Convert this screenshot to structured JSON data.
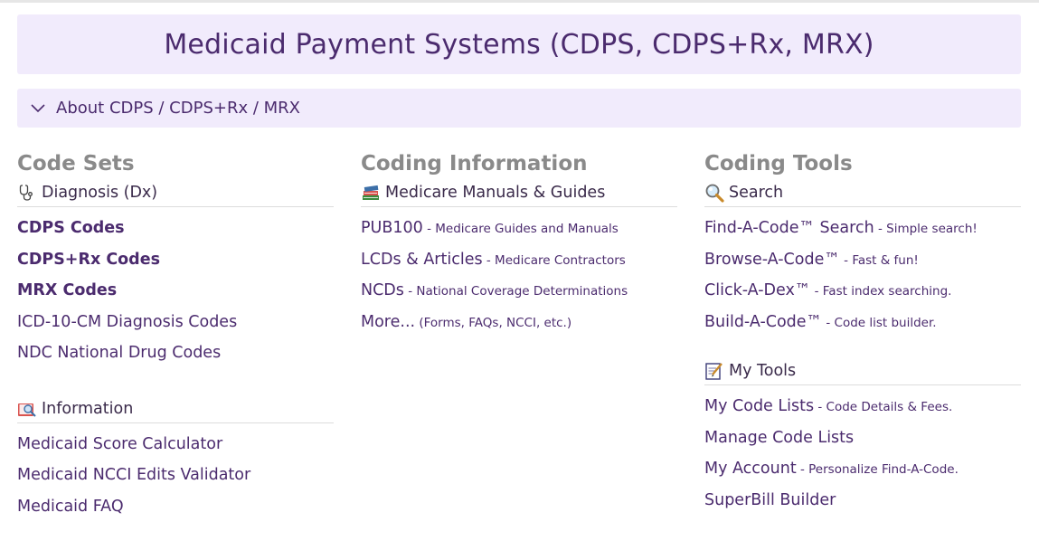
{
  "header": {
    "title": "Medicaid Payment Systems (CDPS, CDPS+Rx, MRX)"
  },
  "about": {
    "label": "About CDPS / CDPS+Rx / MRX",
    "icon": "chevron-down-icon"
  },
  "columns": {
    "code_sets": {
      "title": "Code Sets",
      "diagnosis": {
        "heading": "Diagnosis (Dx)",
        "icon": "stethoscope-icon",
        "items": [
          {
            "label": "CDPS Codes"
          },
          {
            "label": "CDPS+Rx Codes"
          },
          {
            "label": "MRX Codes"
          },
          {
            "label": "ICD-10-CM Diagnosis Codes"
          },
          {
            "label": "NDC National Drug Codes"
          }
        ]
      },
      "information": {
        "heading": "Information",
        "icon": "book-search-icon",
        "items": [
          {
            "label": "Medicaid Score Calculator"
          },
          {
            "label": "Medicaid NCCI Edits Validator"
          },
          {
            "label": "Medicaid FAQ"
          }
        ]
      }
    },
    "coding_information": {
      "title": "Coding Information",
      "manuals": {
        "heading": "Medicare Manuals & Guides",
        "icon": "books-icon",
        "items": [
          {
            "label": "PUB100",
            "desc": " - Medicare Guides and Manuals"
          },
          {
            "label": "LCDs & Articles",
            "desc": " - Medicare Contractors"
          },
          {
            "label": "NCDs",
            "desc": " - National Coverage Determinations"
          },
          {
            "label": "More...",
            "desc": " (Forms, FAQs, NCCI, etc.)"
          }
        ]
      }
    },
    "coding_tools": {
      "title": "Coding Tools",
      "search": {
        "heading": "Search",
        "icon": "magnifier-icon",
        "items": [
          {
            "label": "Find-A-Code™ Search",
            "desc": " - Simple search!"
          },
          {
            "label": "Browse-A-Code™",
            "desc": " - Fast & fun!"
          },
          {
            "label": "Click-A-Dex™",
            "desc": " - Fast index searching."
          },
          {
            "label": "Build-A-Code™",
            "desc": " - Code list builder."
          }
        ]
      },
      "my_tools": {
        "heading": "My Tools",
        "icon": "notepad-icon",
        "items": [
          {
            "label": "My Code Lists",
            "desc": " - Code Details & Fees."
          },
          {
            "label": "Manage Code Lists",
            "desc": ""
          },
          {
            "label": "My Account",
            "desc": " - Personalize Find-A-Code."
          },
          {
            "label": "SuperBill Builder",
            "desc": ""
          }
        ]
      }
    }
  },
  "colors": {
    "banner_bg": "#f1ebfc",
    "link": "#4b2b6e",
    "column_title": "#8a8a8a"
  }
}
